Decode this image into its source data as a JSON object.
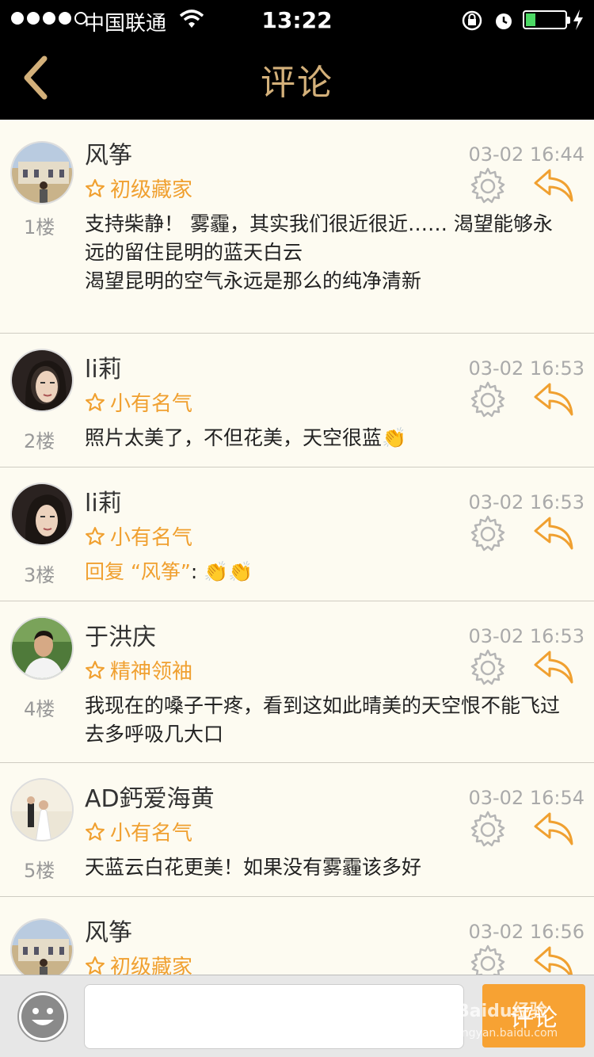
{
  "status_bar": {
    "carrier": "中国联通",
    "time": "13:22"
  },
  "nav": {
    "title": "评论"
  },
  "comments": [
    {
      "name": "风筝",
      "rank": "初级藏家",
      "time": "03-02 16:44",
      "floor": "1楼",
      "text": "支持柴静！ 雾霾，其实我们很近很近…… 渴望能够永远的留住昆明的蓝天白云\n渴望昆明的空气永远是那么的纯净清新"
    },
    {
      "name": "li莉",
      "rank": "小有名气",
      "time": "03-02 16:53",
      "floor": "2楼",
      "text": "照片太美了，不但花美，天空很蓝👏"
    },
    {
      "name": "li莉",
      "rank": "小有名气",
      "time": "03-02 16:53",
      "floor": "3楼",
      "reply_prefix": "回复 “风筝”",
      "text": ": 👏👏"
    },
    {
      "name": "于洪庆",
      "rank": "精神领袖",
      "time": "03-02 16:53",
      "floor": "4楼",
      "text": "我现在的嗓子干疼，看到这如此晴美的天空恨不能飞过去多呼吸几大口"
    },
    {
      "name": "AD鈣爱海黄",
      "rank": "小有名气",
      "time": "03-02 16:54",
      "floor": "5楼",
      "text": "天蓝云白花更美！如果没有雾霾该多好"
    },
    {
      "name": "风筝",
      "rank": "初级藏家",
      "time": "03-02 16:56",
      "floor": "",
      "text": ""
    }
  ],
  "input_bar": {
    "placeholder": "",
    "send_label": "评论"
  },
  "watermark": {
    "brand": "Baidu经验",
    "url": "jingyan.baidu.com"
  },
  "colors": {
    "accent": "#f0a030",
    "nav_title": "#d3b07a",
    "background": "#fdfbf1"
  }
}
